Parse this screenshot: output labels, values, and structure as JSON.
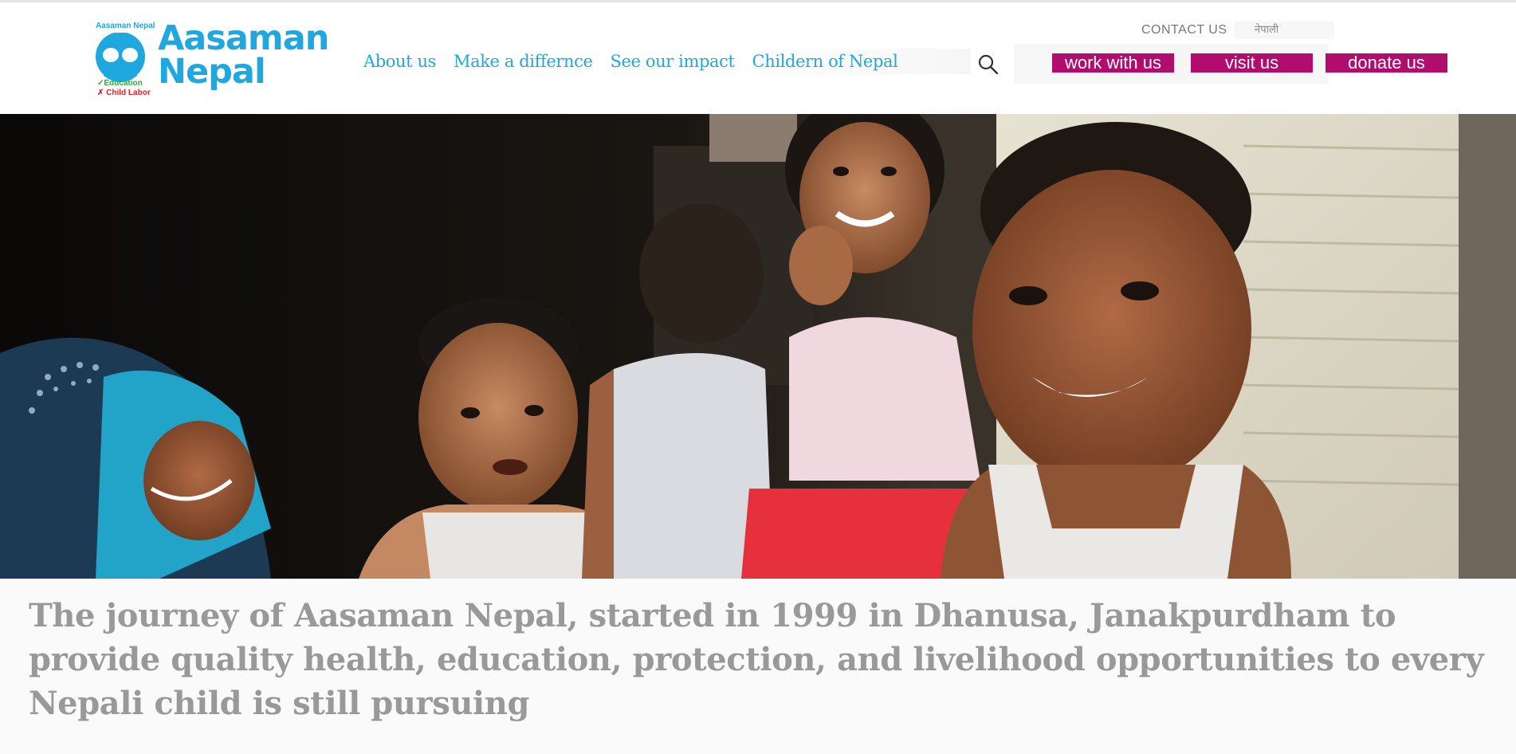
{
  "brand": {
    "small_name": "Aasaman Nepal",
    "name_line1": "Aasaman",
    "name_line2": "Nepal",
    "tagline_education": "✓Education",
    "tagline_labor": "✗ Child Labor",
    "color": "#1fa8e0"
  },
  "nav": {
    "items": [
      {
        "label": "About us"
      },
      {
        "label": "Make a differnce"
      },
      {
        "label": "See our impact"
      },
      {
        "label": "Childern of Nepal"
      }
    ]
  },
  "top_bar": {
    "contact": "CONTACT US",
    "language": "नेपाली"
  },
  "buttons": {
    "work": "work with us",
    "visit": "visit us",
    "donate": "donate us",
    "color": "#b10d6f"
  },
  "hero": {
    "caption": "The journey of Aasaman Nepal, started in 1999 in Dhanusa, Janakpurdham to provide quality health, education, protection, and livelihood opportunities to every Nepali child is still pursuing"
  },
  "icons": {
    "search": "search-icon",
    "logo": "logo-icon"
  }
}
